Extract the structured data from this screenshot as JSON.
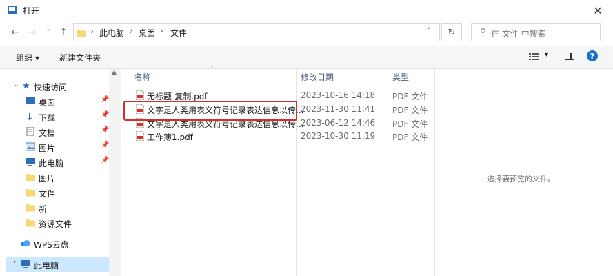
{
  "window": {
    "title": "打开"
  },
  "nav": {
    "breadcrumb": [
      "此电脑",
      "桌面",
      "文件"
    ],
    "search_placeholder": "在 文件 中搜索"
  },
  "toolbar": {
    "organize_label": "组织 ▾",
    "new_folder_label": "新建文件夹"
  },
  "sidebar": {
    "items": [
      {
        "label": "快速访问",
        "icon": "star-icon",
        "pinned": false
      },
      {
        "label": "桌面",
        "icon": "desktop-icon",
        "pinned": true
      },
      {
        "label": "下载",
        "icon": "download-icon",
        "pinned": true
      },
      {
        "label": "文档",
        "icon": "document-icon",
        "pinned": true
      },
      {
        "label": "图片",
        "icon": "pictures-icon",
        "pinned": true
      },
      {
        "label": "此电脑",
        "icon": "computer-icon",
        "pinned": true
      },
      {
        "label": "图片",
        "icon": "folder-icon",
        "pinned": false
      },
      {
        "label": "文件",
        "icon": "folder-icon",
        "pinned": false
      },
      {
        "label": "新",
        "icon": "folder-icon",
        "pinned": false
      },
      {
        "label": "资源文件",
        "icon": "folder-icon",
        "pinned": false
      },
      {
        "label": "WPS云盘",
        "icon": "cloud-icon",
        "pinned": false
      },
      {
        "label": "此电脑",
        "icon": "computer-icon",
        "pinned": false
      }
    ]
  },
  "filelist": {
    "columns": [
      "名称",
      "修改日期",
      "类型"
    ],
    "rows": [
      {
        "name": "无标题-复制.pdf",
        "date": "2023-10-16 14:18",
        "type": "PDF 文件"
      },
      {
        "name": "文字是人类用表义符号记录表达信息以传...",
        "date": "2023-11-30 11:41",
        "type": "PDF 文件"
      },
      {
        "name": "文字是人类用表义符号记录表达信息以传...",
        "date": "2023-06-12 14:46",
        "type": "PDF 文件"
      },
      {
        "name": "工作簿1.pdf",
        "date": "2023-10-30 11:19",
        "type": "PDF 文件"
      }
    ]
  },
  "preview": {
    "text": "选择要预览的文件。"
  },
  "colors": {
    "accent": "#0063b1",
    "highlight": "#d22e2e",
    "folder": "#f8d775",
    "pdf": "#d9302c"
  }
}
